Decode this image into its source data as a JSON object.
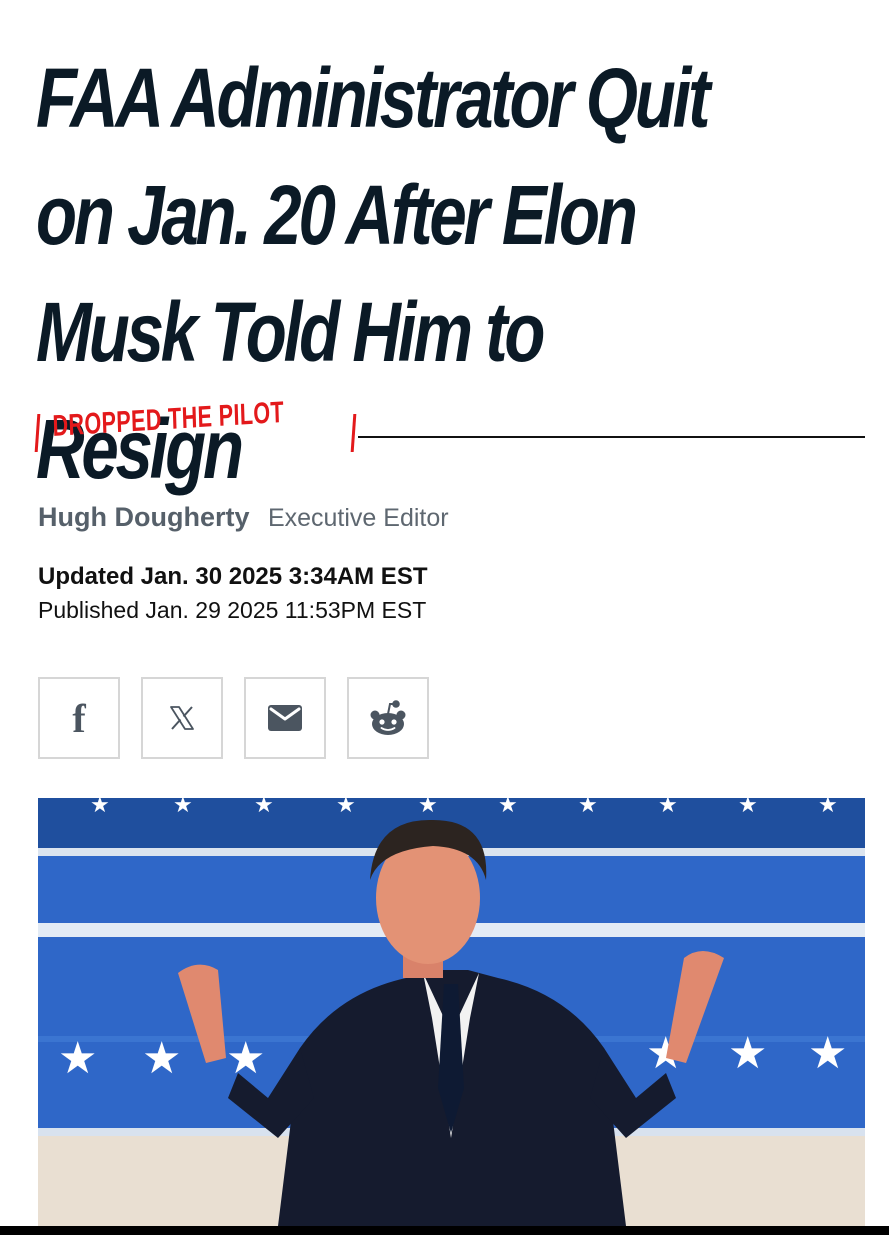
{
  "article": {
    "headline": "FAA Administrator Quit on Jan. 20 After Elon Musk Told Him to Resign",
    "kicker": "DROPPED THE PILOT",
    "author": "Hugh Dougherty",
    "author_role": "Executive Editor",
    "updated": "Updated Jan. 30 2025 3:34AM EST",
    "published": "Published Jan. 29 2025 11:53PM EST"
  },
  "share": {
    "buttons": [
      {
        "name": "facebook",
        "icon": "facebook-icon",
        "glyph": "f"
      },
      {
        "name": "x",
        "icon": "x-icon"
      },
      {
        "name": "email",
        "icon": "mail-icon"
      },
      {
        "name": "reddit",
        "icon": "reddit-icon"
      }
    ]
  },
  "colors": {
    "headline": "#0b1a26",
    "kicker": "#e3191b",
    "byline_gray": "#56606a",
    "banner_blue": "#2f67c8"
  }
}
